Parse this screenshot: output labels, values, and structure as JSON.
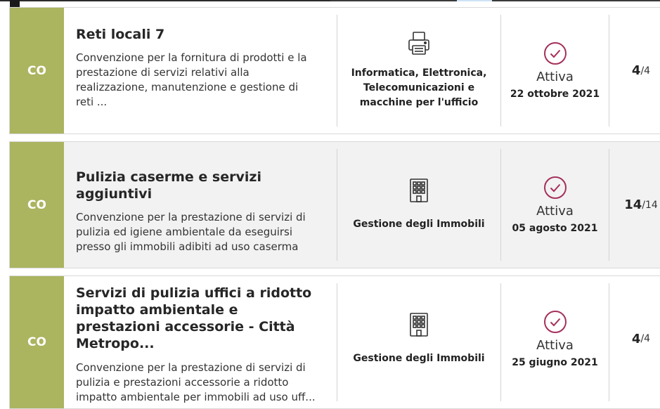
{
  "colors": {
    "badge": "#abb45f",
    "check": "#a3305b"
  },
  "items": [
    {
      "badge": "CO",
      "title": "Reti locali 7",
      "description": "Convenzione per la fornitura di prodotti e la prestazione di servizi relativi alla realizzazione, manutenzione e gestione di reti ...",
      "category_icon": "printer-icon",
      "category": [
        "Informatica, Elettronica,",
        "Telecomunicazioni e",
        "macchine per l'ufficio"
      ],
      "status_icon": "check-circle-icon",
      "status": "Attiva",
      "date": "22 ottobre 2021",
      "count": "4",
      "total": "/4"
    },
    {
      "badge": "CO",
      "title": "Pulizia caserme e servizi aggiuntivi",
      "description": "Convenzione per la prestazione di servizi di pulizia ed igiene ambientale da eseguirsi presso gli immobili adibiti ad uso caserma",
      "category_icon": "building-icon",
      "category": [
        "Gestione degli Immobili"
      ],
      "status_icon": "check-circle-icon",
      "status": "Attiva",
      "date": "05 agosto 2021",
      "count": "14",
      "total": "/14"
    },
    {
      "badge": "CO",
      "title": "Servizi di pulizia uffici a ridotto impatto ambientale e prestazioni accessorie - Città Metropo...",
      "description": "Convenzione per la prestazione di servizi di pulizia e prestazioni accessorie a ridotto impatto ambientale per immobili ad uso uff...",
      "category_icon": "building-icon",
      "category": [
        "Gestione degli Immobili"
      ],
      "status_icon": "check-circle-icon",
      "status": "Attiva",
      "date": "25 giugno 2021",
      "count": "4",
      "total": "/4"
    }
  ]
}
